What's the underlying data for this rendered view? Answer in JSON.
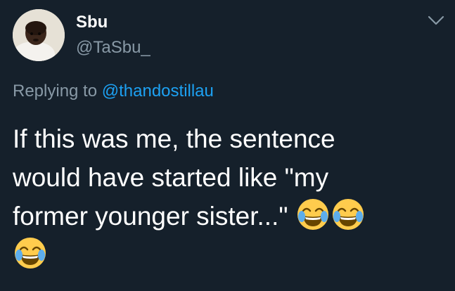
{
  "tweet": {
    "author": {
      "display_name": "Sbu",
      "handle": "@TaSbu_",
      "avatar_icon": "profile-avatar"
    },
    "menu_icon": "chevron-down-icon",
    "reply": {
      "prefix": "Replying to ",
      "mention": "@thandostillau"
    },
    "text_line1": "If this was me, the sentence",
    "text_line2": "would have started like \"my",
    "text_line3": "former younger sister...\" ",
    "emojis": [
      "face-with-tears-of-joy",
      "face-with-tears-of-joy",
      "face-with-tears-of-joy"
    ]
  },
  "colors": {
    "background": "#15202b",
    "primary_text": "#ffffff",
    "secondary_text": "#8899a6",
    "accent": "#1da1f2"
  }
}
